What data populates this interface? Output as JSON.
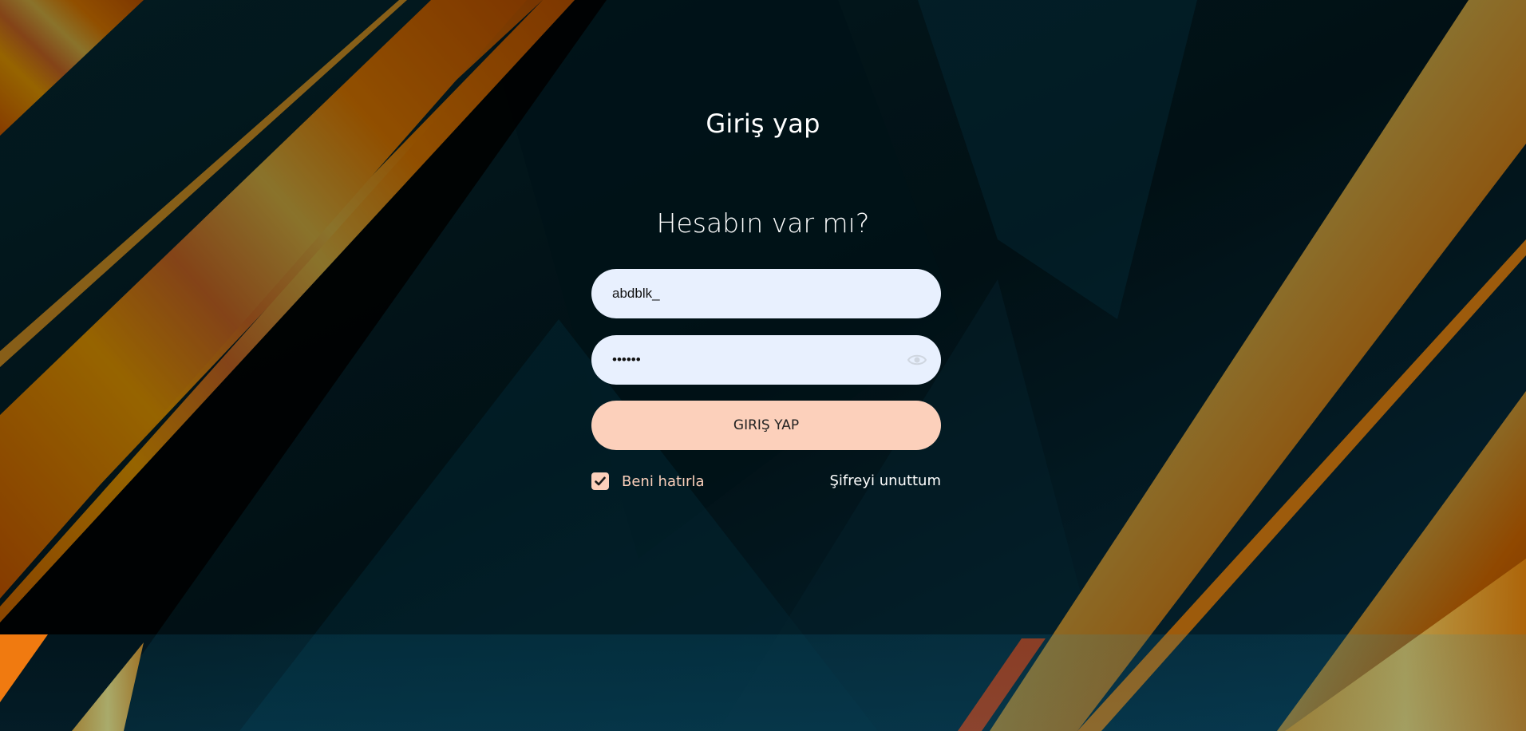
{
  "header": {
    "title": "Giriş yap"
  },
  "form": {
    "subtitle": "Hesabın var mı?",
    "username": {
      "value": "abdblk_"
    },
    "password": {
      "value": "••••••",
      "toggle_icon": "eye-icon"
    },
    "submit_label": "GIRIŞ YAP",
    "remember": {
      "label": "Beni hatırla",
      "checked": true
    },
    "forgot_label": "Şifreyi unuttum"
  },
  "colors": {
    "accent": "#fcd0bb",
    "field_bg": "#e8f0fe",
    "background_dark": "#021a22",
    "stripe_orange": "#c86400"
  }
}
